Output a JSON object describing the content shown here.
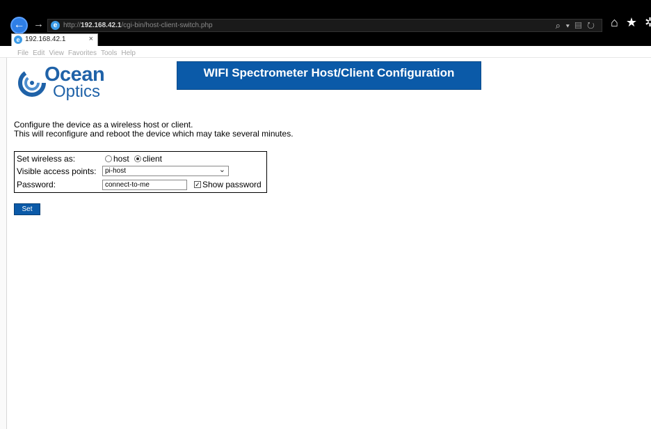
{
  "browser": {
    "back_label": "←",
    "forward_label": "→",
    "address": {
      "prefix": "http://",
      "host": "192.168.42.1",
      "path": "/cgi-bin/host-client-switch.php",
      "tools": "⌕ ▾ ▤ ↻"
    },
    "right_icons": "⌂ ★ ✲",
    "tab": {
      "title": "192.168.42.1",
      "close": "×"
    },
    "menu": [
      "File",
      "Edit",
      "View",
      "Favorites",
      "Tools",
      "Help"
    ]
  },
  "page": {
    "logo": {
      "line1": "Ocean",
      "line2": "Optics",
      "brand_color": "#1f62a8"
    },
    "banner_title": "WIFI Spectrometer Host/Client Configuration",
    "banner_color": "#0b5aa8",
    "intro_line1": "Configure the device as a wireless host or client.",
    "intro_line2": "This will reconfigure and reboot the device which may take several minutes.",
    "form": {
      "mode_label": "Set wireless as:",
      "mode_options": [
        {
          "label": "host",
          "checked": false
        },
        {
          "label": "client",
          "checked": true
        }
      ],
      "ap_label": "Visible access points:",
      "ap_selected": "pi-host",
      "password_label": "Password:",
      "password_value": "connect-to-me",
      "show_password_label": "Show password",
      "show_password_checked": true
    },
    "set_button": "Set"
  }
}
